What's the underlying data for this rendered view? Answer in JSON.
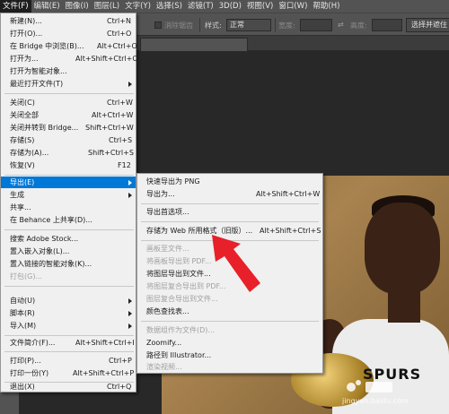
{
  "menubar": {
    "items": [
      "文件(F)",
      "编辑(E)",
      "图像(I)",
      "图层(L)",
      "文字(Y)",
      "选择(S)",
      "滤镜(T)",
      "3D(D)",
      "视图(V)",
      "窗口(W)",
      "帮助(H)"
    ],
    "active_index": 0
  },
  "optbar": {
    "antialias_label": "消除锯齿",
    "style_label": "样式:",
    "style_value": "正常",
    "width_label": "宽度:",
    "height_label": "高度:",
    "select_mask_button": "选择并遮住"
  },
  "file_menu": {
    "items": [
      {
        "label": "新建(N)...",
        "shortcut": "Ctrl+N"
      },
      {
        "label": "打开(O)...",
        "shortcut": "Ctrl+O"
      },
      {
        "label": "在 Bridge 中浏览(B)...",
        "shortcut": "Alt+Ctrl+O"
      },
      {
        "label": "打开为...",
        "shortcut": "Alt+Shift+Ctrl+O"
      },
      {
        "label": "打开为智能对象...",
        "shortcut": ""
      },
      {
        "label": "最近打开文件(T)",
        "shortcut": "",
        "submenu": true
      },
      {
        "label": "关闭(C)",
        "shortcut": "Ctrl+W"
      },
      {
        "label": "关闭全部",
        "shortcut": "Alt+Ctrl+W"
      },
      {
        "label": "关闭并转到 Bridge...",
        "shortcut": "Shift+Ctrl+W"
      },
      {
        "label": "存储(S)",
        "shortcut": "Ctrl+S"
      },
      {
        "label": "存储为(A)...",
        "shortcut": "Shift+Ctrl+S"
      },
      {
        "label": "恢复(V)",
        "shortcut": "F12"
      },
      {
        "label": "导出(E)",
        "shortcut": "",
        "submenu": true,
        "highlighted": true
      },
      {
        "label": "生成",
        "shortcut": "",
        "submenu": true
      },
      {
        "label": "共享...",
        "shortcut": ""
      },
      {
        "label": "在 Behance 上共享(D)...",
        "shortcut": ""
      },
      {
        "label": "搜索 Adobe Stock...",
        "shortcut": ""
      },
      {
        "label": "置入嵌入对象(L)...",
        "shortcut": ""
      },
      {
        "label": "置入链接的智能对象(K)...",
        "shortcut": ""
      },
      {
        "label": "打包(G)...",
        "shortcut": "",
        "disabled": true
      },
      {
        "label": "自动(U)",
        "shortcut": "",
        "submenu": true
      },
      {
        "label": "脚本(R)",
        "shortcut": "",
        "submenu": true
      },
      {
        "label": "导入(M)",
        "shortcut": "",
        "submenu": true
      },
      {
        "label": "文件简介(F)...",
        "shortcut": "Alt+Shift+Ctrl+I"
      },
      {
        "label": "打印(P)...",
        "shortcut": "Ctrl+P"
      },
      {
        "label": "打印一份(Y)",
        "shortcut": "Alt+Shift+Ctrl+P"
      },
      {
        "label": "退出(X)",
        "shortcut": "Ctrl+Q"
      }
    ]
  },
  "export_menu": {
    "items": [
      {
        "label": "快速导出为 PNG",
        "shortcut": ""
      },
      {
        "label": "导出为...",
        "shortcut": "Alt+Shift+Ctrl+W"
      },
      {
        "label": "导出首选项...",
        "shortcut": ""
      },
      {
        "label": "存储为 Web 所用格式（旧版）...",
        "shortcut": "Alt+Shift+Ctrl+S"
      },
      {
        "label": "画板至文件...",
        "shortcut": "",
        "disabled": true
      },
      {
        "label": "将画板导出到 PDF...",
        "shortcut": "",
        "disabled": true
      },
      {
        "label": "将图层导出到文件...",
        "shortcut": ""
      },
      {
        "label": "将图层复合导出到 PDF...",
        "shortcut": "",
        "disabled": true
      },
      {
        "label": "图层复合导出到文件...",
        "shortcut": "",
        "disabled": true
      },
      {
        "label": "颜色查找表...",
        "shortcut": ""
      },
      {
        "label": "数据组作为文件(D)...",
        "shortcut": "",
        "disabled": true
      },
      {
        "label": "Zoomify...",
        "shortcut": ""
      },
      {
        "label": "路径到 Illustrator...",
        "shortcut": ""
      },
      {
        "label": "渲染视频...",
        "shortcut": "",
        "disabled": true
      }
    ]
  },
  "photo": {
    "jersey_text": "SPURS"
  },
  "watermark": {
    "text": "jingyan.baidu.com"
  },
  "colors": {
    "highlight": "#0078d7",
    "annotation_arrow": "#e8202a"
  }
}
